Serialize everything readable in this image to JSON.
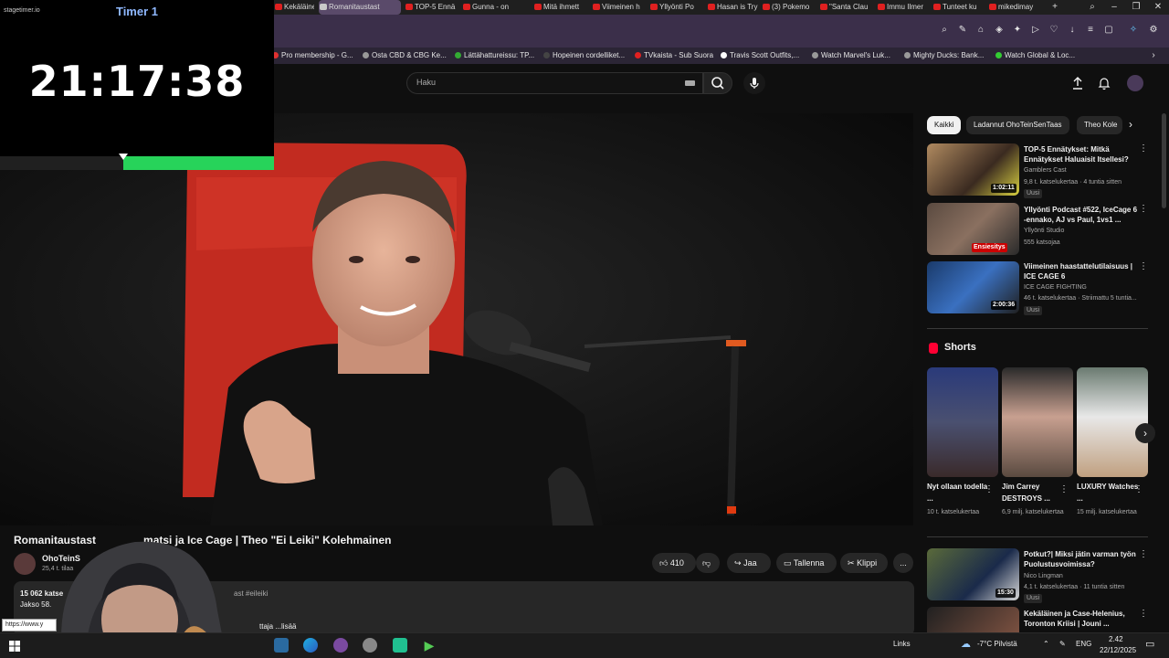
{
  "timer": {
    "logo": "stagetimer.io",
    "name": "Timer 1",
    "time": "21:17:38",
    "progress_fraction": 0.55
  },
  "browser": {
    "tabs": [
      {
        "label": "Kekäläinen",
        "active": false
      },
      {
        "label": "Romanitaustast",
        "active": true
      },
      {
        "label": "TOP-5 Ennä",
        "active": false
      },
      {
        "label": "Gunna - on",
        "active": false
      },
      {
        "label": "Mitä ihmett",
        "active": false
      },
      {
        "label": "Viimeinen h",
        "active": false
      },
      {
        "label": "Yllyönti Po",
        "active": false
      },
      {
        "label": "Hasan is Try",
        "active": false
      },
      {
        "label": "(3) Pokemo",
        "active": false
      },
      {
        "label": "\"Santa Clau",
        "active": false
      },
      {
        "label": "Immu Ilmer",
        "active": false
      },
      {
        "label": "Tunteet ku",
        "active": false
      },
      {
        "label": "mikedimay",
        "active": false
      }
    ],
    "new_tab": "+",
    "bookmarks": [
      "Pro membership - G...",
      "Osta CBD & CBG Ke...",
      "Lättähattureissu: TP...",
      "Hopeinen cordelliket...",
      "TVkaista - Sub Suora",
      "Travis Scott Outfits,...",
      "Watch Marvel's Luk...",
      "Mighty Ducks: Bank...",
      "Watch Global & Loc..."
    ]
  },
  "youtube": {
    "search_placeholder": "Haku",
    "video_title": "Romanitaustast",
    "video_title_rest": "matsi ja Ice Cage | Theo \"Ei Leiki\" Kolehmainen",
    "channel": "OhoTeinS",
    "subscribers": "25,4 t. tilaa",
    "likes": "410",
    "share": "Jaa",
    "save": "Tallenna",
    "clip": "Klippi",
    "more": "...",
    "description": {
      "stats": "15 062 katse",
      "episode": "Jakso 58.",
      "tags": "ast #eileiki",
      "more_prefix": "ttaja",
      "more": "...lisää"
    },
    "url_tooltip": "https://www.y"
  },
  "sidebar": {
    "chips": [
      "Kaikki",
      "Ladannut OhoTeinSenTaas",
      "Theo Kole"
    ],
    "recommendations": [
      {
        "title": "TOP-5 Ennätykset: Mitkä Ennätykset Haluaisit Itsellesi?",
        "channel": "Gamblers Cast",
        "meta": "9,8 t. katselukertaa · 4 tuntia sitten",
        "badge": "Uusi",
        "duration": "1:02:11"
      },
      {
        "title": "Yllyönti Podcast #522, IceCage 6 -ennako, AJ vs Paul, 1vs1 ...",
        "channel": "Yllyönti Studio",
        "meta": "555 katsojaa",
        "badge": "",
        "duration": "Ensiesitys"
      },
      {
        "title": "Viimeinen haastattelutilaisuus | ICE CAGE 6",
        "channel": "ICE CAGE FIGHTING",
        "meta": "46 t. katselukertaa · Striimattu 5 tuntia...",
        "badge": "Uusi",
        "duration": "2:00:36"
      },
      {
        "title": "Potkut?| Miksi jätin varman työn Puolustusvoimissa?",
        "channel": "Nico Lingman",
        "meta": "4,1 t. katselukertaa · 11 tuntia sitten",
        "badge": "Uusi",
        "duration": "15:30"
      },
      {
        "title": "Kekäläinen ja Case-Helenius, Toronton Kriisi | Jouni ...",
        "channel": "",
        "meta": "",
        "badge": "",
        "duration": ""
      }
    ],
    "shorts_heading": "Shorts",
    "shorts": [
      {
        "title": "Nyt ollaan todella ...",
        "views": "10 t. katselukertaa"
      },
      {
        "title": "Jim Carrey DESTROYS ...",
        "views": "6,9 milj. katselukertaa"
      },
      {
        "title": "LUXURY Watches ...",
        "views": "15 milj. katselukertaa"
      }
    ]
  },
  "taskbar": {
    "links": "Links",
    "weather": "-7°C Pilvistä",
    "lang": "ENG",
    "time": "2.42",
    "date": "22/12/2025"
  },
  "colors": {
    "timer_fill": "#27d35a",
    "chip_active": "#f1f1f1",
    "tab_active": "#5a4a6a"
  }
}
